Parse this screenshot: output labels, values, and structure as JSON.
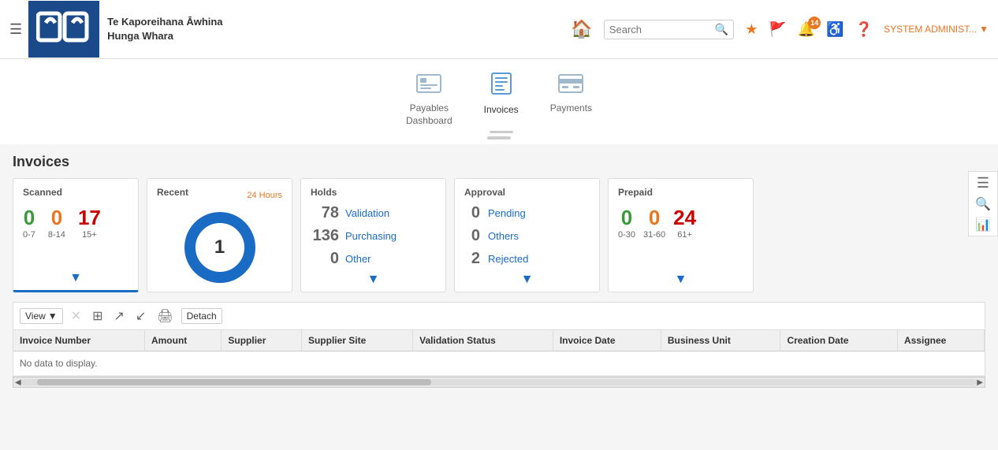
{
  "header": {
    "logo_line1": "Te Kaporeihana Āwhina",
    "logo_line2": "Hunga Whara",
    "search_placeholder": "Search",
    "notification_count": "14",
    "user_label": "SYSTEM ADMINIST...",
    "hamburger_label": "☰"
  },
  "nav_tabs": [
    {
      "id": "payables",
      "label": "Payables\nDashboard",
      "icon": "🖥",
      "active": false
    },
    {
      "id": "invoices",
      "label": "Invoices",
      "icon": "☰",
      "active": true
    },
    {
      "id": "payments",
      "label": "Payments",
      "icon": "🏦",
      "active": false
    }
  ],
  "page": {
    "title": "Invoices"
  },
  "cards": {
    "scanned": {
      "title": "Scanned",
      "ranges": [
        {
          "value": "0",
          "label": "0-7",
          "color": "green"
        },
        {
          "value": "0",
          "label": "8-14",
          "color": "orange"
        },
        {
          "value": "17",
          "label": "15+",
          "color": "red"
        }
      ]
    },
    "recent": {
      "title": "Recent",
      "time_label": "24 Hours",
      "count": "1"
    },
    "holds": {
      "title": "Holds",
      "rows": [
        {
          "value": "78",
          "label": "Validation"
        },
        {
          "value": "136",
          "label": "Purchasing"
        },
        {
          "value": "0",
          "label": "Other"
        }
      ]
    },
    "approval": {
      "title": "Approval",
      "rows": [
        {
          "value": "0",
          "label": "Pending"
        },
        {
          "value": "0",
          "label": "Others"
        },
        {
          "value": "2",
          "label": "Rejected"
        }
      ]
    },
    "prepaid": {
      "title": "Prepaid",
      "columns": [
        {
          "value": "0",
          "label": "0-30",
          "color": "green"
        },
        {
          "value": "0",
          "label": "31-60",
          "color": "orange"
        },
        {
          "value": "24",
          "label": "61+",
          "color": "red"
        }
      ]
    }
  },
  "toolbar": {
    "view_label": "View",
    "detach_label": "Detach"
  },
  "table": {
    "columns": [
      "Invoice Number",
      "Amount",
      "Supplier",
      "Supplier Site",
      "Validation Status",
      "Invoice Date",
      "Business Unit",
      "Creation Date",
      "Assignee"
    ],
    "no_data_message": "No data to display."
  },
  "sidebar_right": {
    "icons": [
      "📄",
      "🔍",
      "📊"
    ]
  }
}
